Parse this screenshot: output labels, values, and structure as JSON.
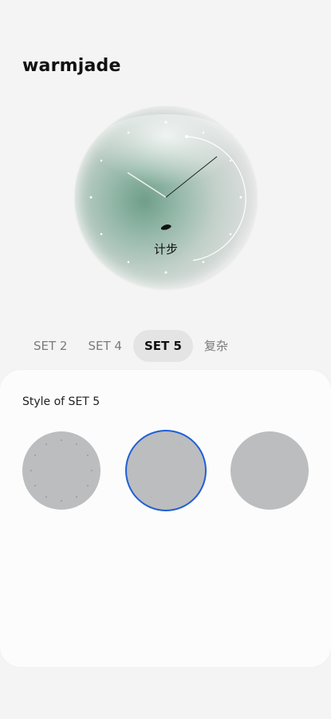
{
  "header": {
    "title": "warmjade"
  },
  "watch_preview": {
    "complication_label": "计步",
    "accent": "#7fa895"
  },
  "tabs": [
    {
      "label": "SET 2",
      "active": false
    },
    {
      "label": "SET 4",
      "active": false
    },
    {
      "label": "SET 5",
      "active": true
    },
    {
      "label": "复杂",
      "active": false
    }
  ],
  "style_panel": {
    "title": "Style of SET 5",
    "options": [
      {
        "name": "style-1",
        "selected": false
      },
      {
        "name": "style-2",
        "selected": true
      },
      {
        "name": "style-3",
        "selected": false
      }
    ],
    "selection_color": "#1f5fd6"
  }
}
